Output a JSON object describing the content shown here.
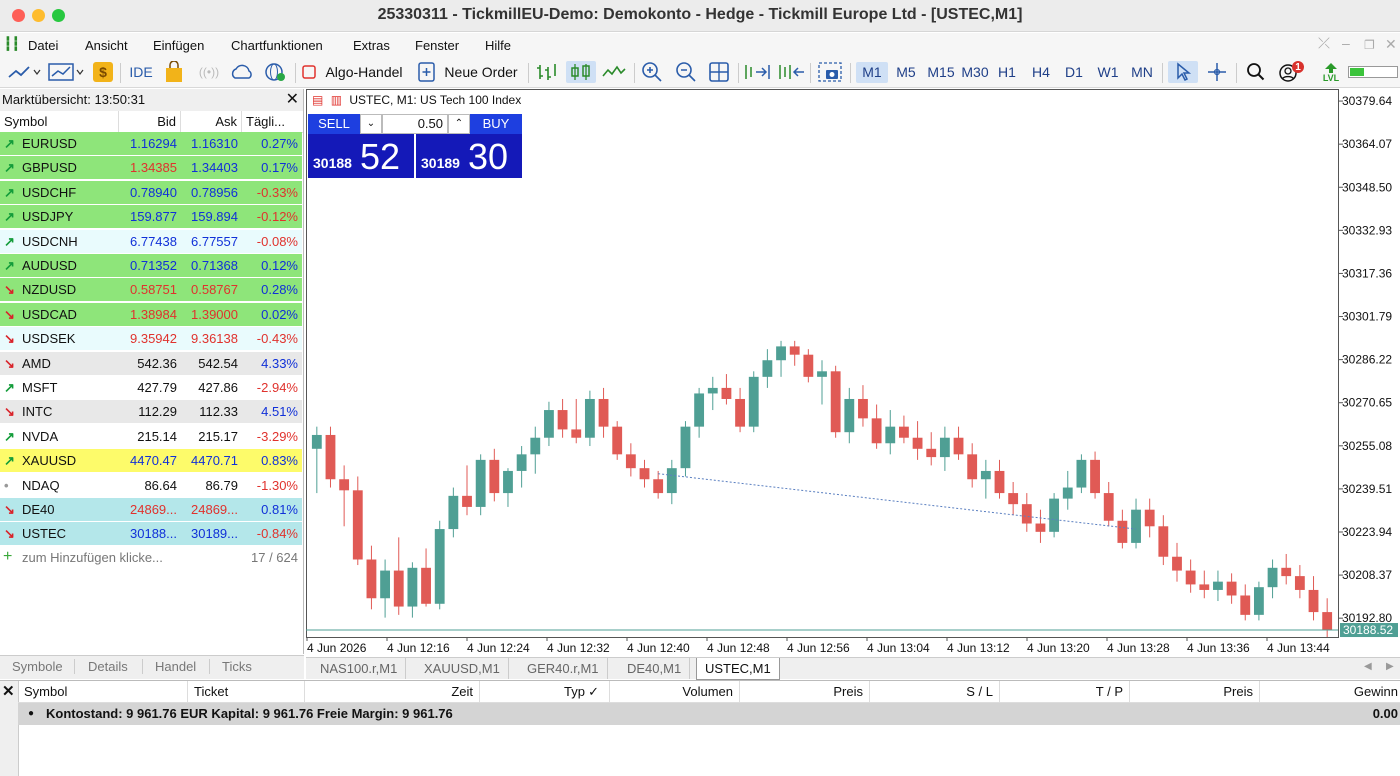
{
  "window": {
    "title": "25330311 - TickmillEU-Demo: Demokonto - Hedge - Tickmill Europe Ltd - [USTEC,M1]"
  },
  "menu": [
    "Datei",
    "Ansicht",
    "Einfügen",
    "Chartfunktionen",
    "Extras",
    "Fenster",
    "Hilfe"
  ],
  "toolbar": {
    "ide": "IDE",
    "algo": "Algo-Handel",
    "new_order": "Neue Order",
    "timeframes": [
      "M1",
      "M5",
      "M15",
      "M30",
      "H1",
      "H4",
      "D1",
      "W1",
      "MN"
    ],
    "active_timeframe": "M1",
    "notifications": "1",
    "lvl": "LVL"
  },
  "market_watch": {
    "header": "Marktübersicht: 13:50:31",
    "columns": [
      "Symbol",
      "Bid",
      "Ask",
      "Tägli..."
    ],
    "rows": [
      {
        "symbol": "EURUSD",
        "bid": "1.16294",
        "ask": "1.16310",
        "daily": "0.27%",
        "dir": "up",
        "bg": "#8ee57a",
        "bidc": "b",
        "askc": "b",
        "dc": "b"
      },
      {
        "symbol": "GBPUSD",
        "bid": "1.34385",
        "ask": "1.34403",
        "daily": "0.17%",
        "dir": "up",
        "bg": "#8ee57a",
        "bidc": "r",
        "askc": "b",
        "dc": "b"
      },
      {
        "symbol": "USDCHF",
        "bid": "0.78940",
        "ask": "0.78956",
        "daily": "-0.33%",
        "dir": "up",
        "bg": "#8ee57a",
        "bidc": "b",
        "askc": "b",
        "dc": "r"
      },
      {
        "symbol": "USDJPY",
        "bid": "159.877",
        "ask": "159.894",
        "daily": "-0.12%",
        "dir": "up",
        "bg": "#8ee57a",
        "bidc": "b",
        "askc": "b",
        "dc": "r"
      },
      {
        "symbol": "USDCNH",
        "bid": "6.77438",
        "ask": "6.77557",
        "daily": "-0.08%",
        "dir": "up",
        "bg": "#e9fbfd",
        "bidc": "b",
        "askc": "b",
        "dc": "r"
      },
      {
        "symbol": "AUDUSD",
        "bid": "0.71352",
        "ask": "0.71368",
        "daily": "0.12%",
        "dir": "up",
        "bg": "#8ee57a",
        "bidc": "b",
        "askc": "b",
        "dc": "b"
      },
      {
        "symbol": "NZDUSD",
        "bid": "0.58751",
        "ask": "0.58767",
        "daily": "0.28%",
        "dir": "dn",
        "bg": "#8ee57a",
        "bidc": "r",
        "askc": "r",
        "dc": "b"
      },
      {
        "symbol": "USDCAD",
        "bid": "1.38984",
        "ask": "1.39000",
        "daily": "0.02%",
        "dir": "dn",
        "bg": "#8ee57a",
        "bidc": "r",
        "askc": "r",
        "dc": "b"
      },
      {
        "symbol": "USDSEK",
        "bid": "9.35942",
        "ask": "9.36138",
        "daily": "-0.43%",
        "dir": "dn",
        "bg": "#e9fbfd",
        "bidc": "r",
        "askc": "r",
        "dc": "r"
      },
      {
        "symbol": "AMD",
        "bid": "542.36",
        "ask": "542.54",
        "daily": "4.33%",
        "dir": "dn",
        "bg": "#e8e8e8",
        "bidc": "k",
        "askc": "k",
        "dc": "b"
      },
      {
        "symbol": "MSFT",
        "bid": "427.79",
        "ask": "427.86",
        "daily": "-2.94%",
        "dir": "up",
        "bg": "#ffffff",
        "bidc": "k",
        "askc": "k",
        "dc": "r"
      },
      {
        "symbol": "INTC",
        "bid": "112.29",
        "ask": "112.33",
        "daily": "4.51%",
        "dir": "dn",
        "bg": "#e8e8e8",
        "bidc": "k",
        "askc": "k",
        "dc": "b"
      },
      {
        "symbol": "NVDA",
        "bid": "215.14",
        "ask": "215.17",
        "daily": "-3.29%",
        "dir": "up",
        "bg": "#ffffff",
        "bidc": "k",
        "askc": "k",
        "dc": "r"
      },
      {
        "symbol": "XAUUSD",
        "bid": "4470.47",
        "ask": "4470.71",
        "daily": "0.83%",
        "dir": "up",
        "bg": "#fdfb6a",
        "bidc": "b",
        "askc": "b",
        "dc": "b"
      },
      {
        "symbol": "NDAQ",
        "bid": "86.64",
        "ask": "86.79",
        "daily": "-1.30%",
        "dir": "none",
        "bg": "#ffffff",
        "bidc": "k",
        "askc": "k",
        "dc": "r"
      },
      {
        "symbol": "DE40",
        "bid": "24869...",
        "ask": "24869...",
        "daily": "0.81%",
        "dir": "dn",
        "bg": "#b4e7ea",
        "bidc": "r",
        "askc": "r",
        "dc": "b"
      },
      {
        "symbol": "USTEC",
        "bid": "30188...",
        "ask": "30189...",
        "daily": "-0.84%",
        "dir": "dn",
        "bg": "#b4e7ea",
        "bidc": "b",
        "askc": "b",
        "dc": "r"
      }
    ],
    "add_label": "zum Hinzufügen klicke...",
    "count": "17 / 624",
    "tabs": [
      "Symbole",
      "Details",
      "Handel",
      "Ticks"
    ]
  },
  "chart": {
    "info": "USTEC, M1:  US Tech 100 Index",
    "sell_label": "SELL",
    "buy_label": "BUY",
    "volume": "0.50",
    "sell_small": "30188",
    "sell_big": "52",
    "buy_small": "30189",
    "buy_big": "30",
    "current_price": "30188.52"
  },
  "chart_data": {
    "type": "candlestick",
    "y_ticks": [
      "30379.64",
      "30364.07",
      "30348.50",
      "30332.93",
      "30317.36",
      "30301.79",
      "30286.22",
      "30270.65",
      "30255.08",
      "30239.51",
      "30223.94",
      "30208.37",
      "30192.80"
    ],
    "x_ticks": [
      "4 Jun 2026",
      "4 Jun 12:16",
      "4 Jun 12:24",
      "4 Jun 12:32",
      "4 Jun 12:40",
      "4 Jun 12:48",
      "4 Jun 12:56",
      "4 Jun 13:04",
      "4 Jun 13:12",
      "4 Jun 13:20",
      "4 Jun 13:28",
      "4 Jun 13:36",
      "4 Jun 13:44"
    ],
    "ylim": [
      30186,
      30384
    ],
    "current": 30188.52,
    "colors": {
      "up": "#4f9f94",
      "down": "#e05a55"
    },
    "ohlc": [
      [
        30254,
        30262,
        30238,
        30259
      ],
      [
        30259,
        30262,
        30240,
        30243
      ],
      [
        30243,
        30248,
        30226,
        30239
      ],
      [
        30239,
        30244,
        30212,
        30214
      ],
      [
        30214,
        30219,
        30196,
        30200
      ],
      [
        30200,
        30214,
        30193,
        30210
      ],
      [
        30210,
        30222,
        30194,
        30197
      ],
      [
        30197,
        30213,
        30193,
        30211
      ],
      [
        30211,
        30218,
        30197,
        30198
      ],
      [
        30198,
        30228,
        30196,
        30225
      ],
      [
        30225,
        30240,
        30222,
        30237
      ],
      [
        30237,
        30248,
        30230,
        30233
      ],
      [
        30233,
        30252,
        30230,
        30250
      ],
      [
        30250,
        30254,
        30235,
        30238
      ],
      [
        30238,
        30247,
        30233,
        30246
      ],
      [
        30246,
        30255,
        30240,
        30252
      ],
      [
        30252,
        30262,
        30245,
        30258
      ],
      [
        30258,
        30271,
        30255,
        30268
      ],
      [
        30268,
        30272,
        30258,
        30261
      ],
      [
        30261,
        30272,
        30256,
        30258
      ],
      [
        30258,
        30275,
        30255,
        30272
      ],
      [
        30272,
        30276,
        30258,
        30262
      ],
      [
        30262,
        30264,
        30250,
        30252
      ],
      [
        30252,
        30256,
        30244,
        30247
      ],
      [
        30247,
        30250,
        30240,
        30243
      ],
      [
        30243,
        30246,
        30236,
        30238
      ],
      [
        30238,
        30250,
        30234,
        30247
      ],
      [
        30247,
        30264,
        30244,
        30262
      ],
      [
        30262,
        30276,
        30258,
        30274
      ],
      [
        30274,
        30280,
        30268,
        30276
      ],
      [
        30276,
        30281,
        30270,
        30272
      ],
      [
        30272,
        30276,
        30260,
        30262
      ],
      [
        30262,
        30282,
        30260,
        30280
      ],
      [
        30280,
        30290,
        30276,
        30286
      ],
      [
        30286,
        30293,
        30280,
        30291
      ],
      [
        30291,
        30293,
        30284,
        30288
      ],
      [
        30288,
        30290,
        30278,
        30280
      ],
      [
        30280,
        30286,
        30270,
        30282
      ],
      [
        30282,
        30284,
        30258,
        30260
      ],
      [
        30260,
        30276,
        30256,
        30272
      ],
      [
        30272,
        30277,
        30262,
        30265
      ],
      [
        30265,
        30270,
        30254,
        30256
      ],
      [
        30256,
        30268,
        30252,
        30262
      ],
      [
        30262,
        30266,
        30256,
        30258
      ],
      [
        30258,
        30264,
        30250,
        30254
      ],
      [
        30254,
        30260,
        30248,
        30251
      ],
      [
        30251,
        30262,
        30246,
        30258
      ],
      [
        30258,
        30262,
        30250,
        30252
      ],
      [
        30252,
        30256,
        30240,
        30243
      ],
      [
        30243,
        30250,
        30236,
        30246
      ],
      [
        30246,
        30250,
        30236,
        30238
      ],
      [
        30238,
        30242,
        30230,
        30234
      ],
      [
        30234,
        30238,
        30224,
        30227
      ],
      [
        30227,
        30232,
        30220,
        30224
      ],
      [
        30224,
        30238,
        30222,
        30236
      ],
      [
        30236,
        30246,
        30232,
        30240
      ],
      [
        30240,
        30252,
        30238,
        30250
      ],
      [
        30250,
        30253,
        30236,
        30238
      ],
      [
        30238,
        30242,
        30226,
        30228
      ],
      [
        30228,
        30232,
        30218,
        30220
      ],
      [
        30220,
        30236,
        30218,
        30232
      ],
      [
        30232,
        30236,
        30222,
        30226
      ],
      [
        30226,
        30230,
        30212,
        30215
      ],
      [
        30215,
        30220,
        30206,
        30210
      ],
      [
        30210,
        30214,
        30202,
        30205
      ],
      [
        30205,
        30210,
        30200,
        30203
      ],
      [
        30203,
        30210,
        30199,
        30206
      ],
      [
        30206,
        30209,
        30198,
        30201
      ],
      [
        30201,
        30205,
        30192,
        30194
      ],
      [
        30194,
        30206,
        30192,
        30204
      ],
      [
        30204,
        30214,
        30200,
        30211
      ],
      [
        30211,
        30216,
        30205,
        30208
      ],
      [
        30208,
        30212,
        30200,
        30203
      ],
      [
        30203,
        30208,
        30192,
        30195
      ],
      [
        30195,
        30200,
        30186,
        30188.52
      ]
    ],
    "trade_line": {
      "from_index": 25,
      "from_price": 30245,
      "to_index": 60,
      "to_price": 30225
    }
  },
  "symbol_tabs": [
    "NAS100.r,M1",
    "XAUUSD,M1",
    "GER40.r,M1",
    "DE40,M1",
    "USTEC,M1"
  ],
  "active_symbol_tab": "USTEC,M1",
  "terminal": {
    "columns": [
      "Symbol",
      "Ticket",
      "Zeit",
      "Typ",
      "Volumen",
      "Preis",
      "S / L",
      "T / P",
      "Preis",
      "Gewinn"
    ],
    "balance": "Kontostand: 9 961.76 EUR  Kapital: 9 961.76  Freie Margin: 9 961.76",
    "profit": "0.00"
  }
}
